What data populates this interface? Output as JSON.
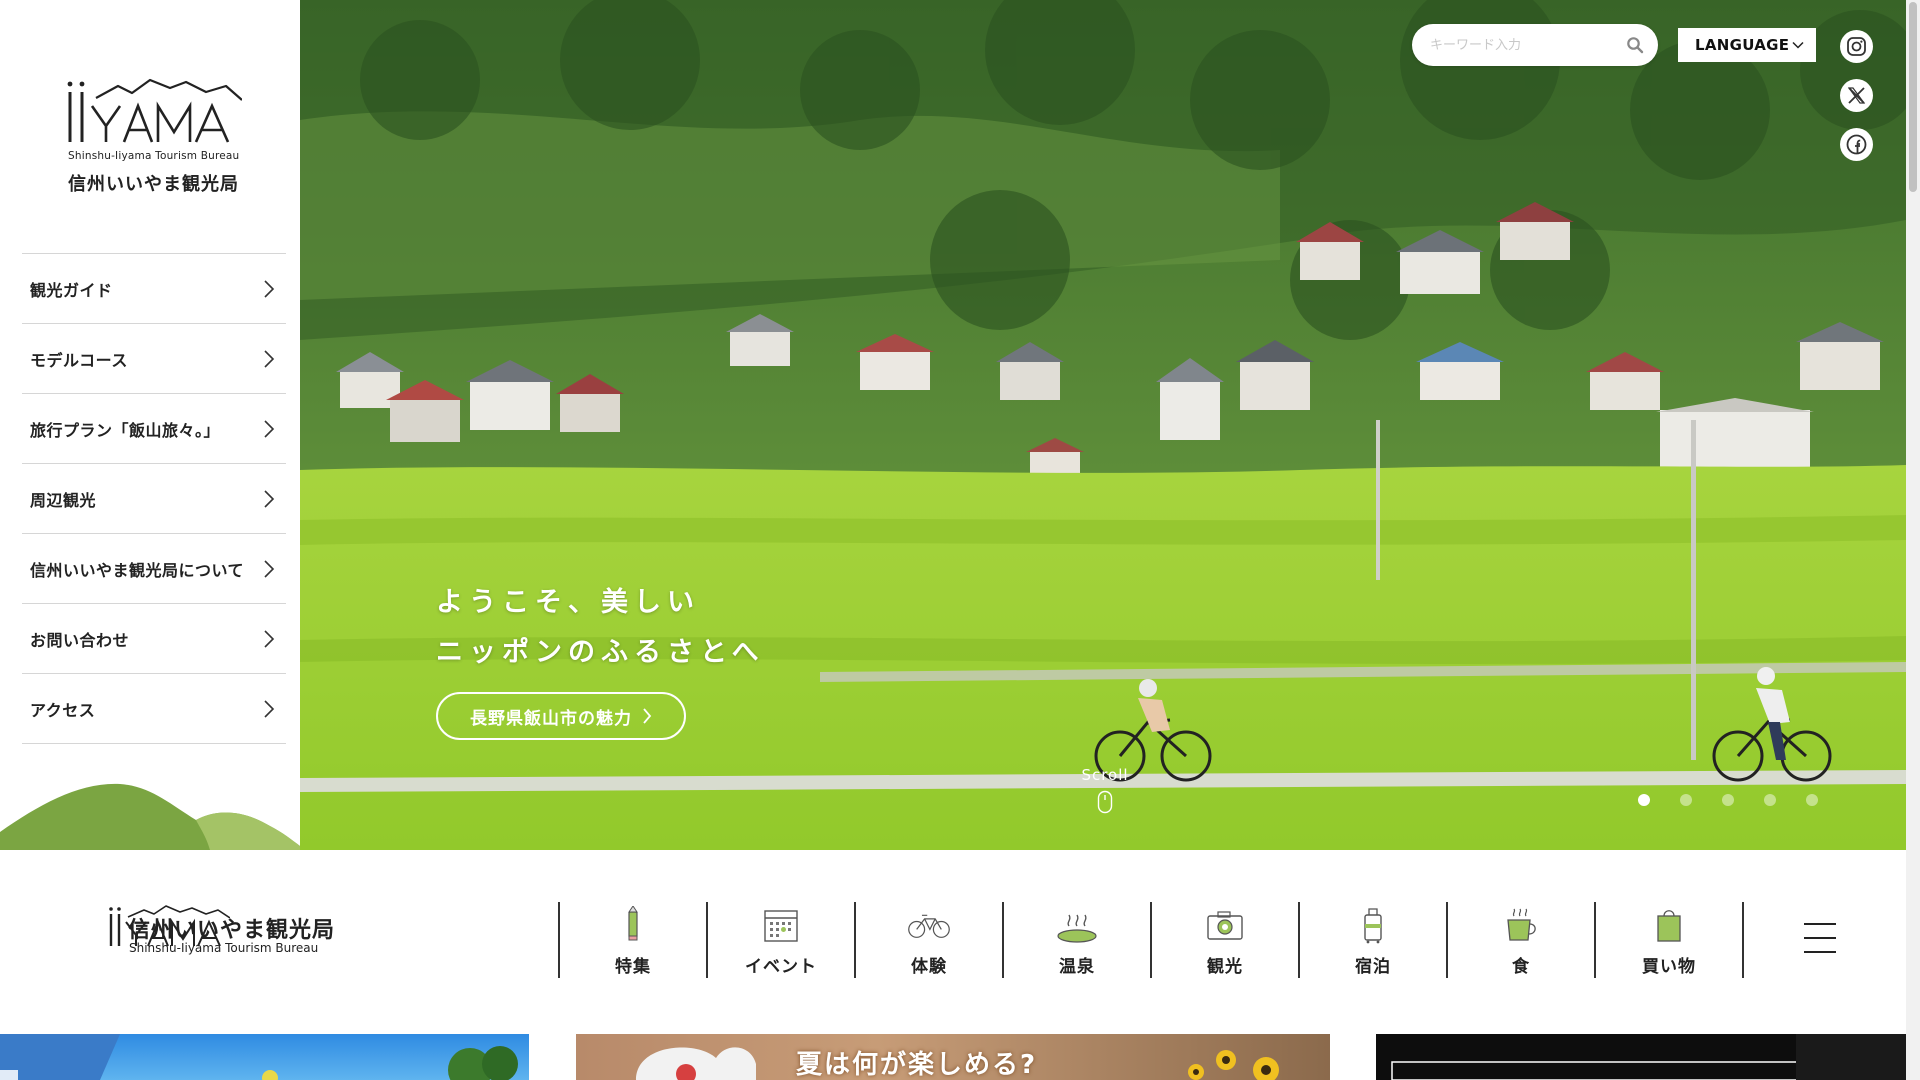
{
  "brand": {
    "logo_en": "Shinshu-Iiyama Tourism Bureau",
    "logo_jp": "信州いいやま観光局"
  },
  "sidebar": {
    "items": [
      {
        "label": "観光ガイド"
      },
      {
        "label": "モデルコース"
      },
      {
        "label": "旅行プラン「飯山旅々。」"
      },
      {
        "label": "周辺観光"
      },
      {
        "label": "信州いいやま観光局について"
      },
      {
        "label": "お問い合わせ"
      },
      {
        "label": "アクセス"
      }
    ]
  },
  "header": {
    "search_placeholder": "キーワード入力",
    "language_label": "LANGUAGE",
    "social": [
      "instagram-icon",
      "x-icon",
      "facebook-icon"
    ]
  },
  "hero": {
    "line1": "ようこそ、美しい",
    "line2": "ニッポンのふるさとへ",
    "button_label": "長野県飯山市の魅力",
    "scroll_label": "Scroll",
    "slide_count": 5,
    "active_slide": 1
  },
  "category_nav": {
    "items": [
      {
        "label": "特集",
        "icon": "pencil-icon"
      },
      {
        "label": "イベント",
        "icon": "calendar-icon"
      },
      {
        "label": "体験",
        "icon": "bicycle-icon"
      },
      {
        "label": "温泉",
        "icon": "hot-spring-icon"
      },
      {
        "label": "観光",
        "icon": "camera-icon"
      },
      {
        "label": "宿泊",
        "icon": "suitcase-icon"
      },
      {
        "label": "食",
        "icon": "cup-icon"
      },
      {
        "label": "買い物",
        "icon": "shopping-bag-icon"
      }
    ]
  },
  "cards": {
    "card2_headline": "夏は何が楽しめる?"
  },
  "colors": {
    "accent_green": "#7ba542",
    "hill_light": "#a8c66a",
    "field_green": "#9fd136"
  }
}
